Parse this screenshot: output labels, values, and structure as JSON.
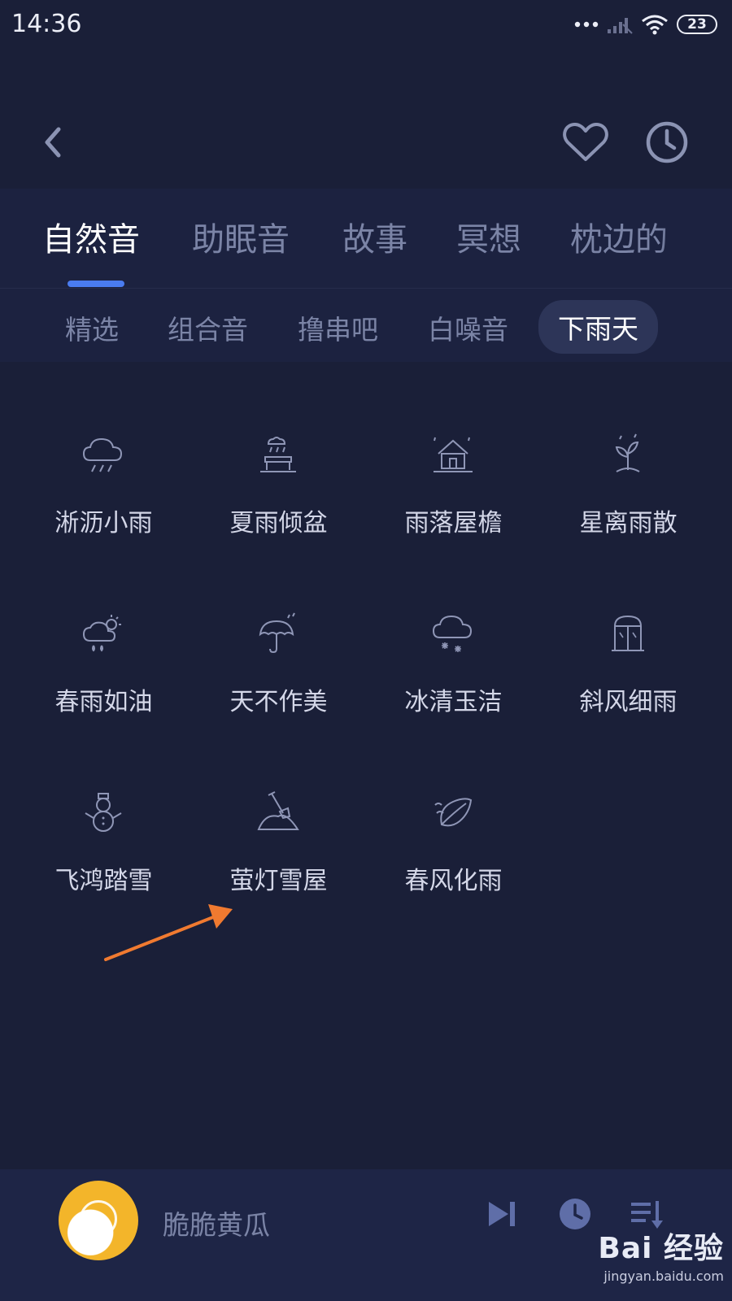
{
  "status": {
    "time": "14:36",
    "battery": "23"
  },
  "nav": {
    "back_icon": "chevron-left-icon",
    "favorite_icon": "heart-icon",
    "history_icon": "clock-icon"
  },
  "tabs": [
    {
      "label": "自然音",
      "active": true
    },
    {
      "label": "助眠音",
      "active": false
    },
    {
      "label": "故事",
      "active": false
    },
    {
      "label": "冥想",
      "active": false
    },
    {
      "label": "枕边的",
      "active": false
    }
  ],
  "subtabs": [
    {
      "label": "精选",
      "active": false
    },
    {
      "label": "组合音",
      "active": false
    },
    {
      "label": "撸串吧",
      "active": false
    },
    {
      "label": "白噪音",
      "active": false
    },
    {
      "label": "下雨天",
      "active": true
    }
  ],
  "sounds": [
    {
      "label": "淅沥小雨",
      "icon": "rain-cloud-icon"
    },
    {
      "label": "夏雨倾盆",
      "icon": "downpour-bench-icon"
    },
    {
      "label": "雨落屋檐",
      "icon": "house-rain-icon"
    },
    {
      "label": "星离雨散",
      "icon": "sprout-rain-icon"
    },
    {
      "label": "春雨如油",
      "icon": "sun-cloud-rain-icon"
    },
    {
      "label": "天不作美",
      "icon": "umbrella-icon"
    },
    {
      "label": "冰清玉洁",
      "icon": "snow-cloud-icon"
    },
    {
      "label": "斜风细雨",
      "icon": "window-icon"
    },
    {
      "label": "飞鸿踏雪",
      "icon": "snowman-icon"
    },
    {
      "label": "萤灯雪屋",
      "icon": "shovel-snow-icon"
    },
    {
      "label": "春风化雨",
      "icon": "leaf-icon"
    }
  ],
  "player": {
    "track": "脆脆黄瓜",
    "album_icon": "play-icon",
    "next_icon": "skip-next-icon",
    "timer_icon": "clock-icon",
    "playlist_icon": "playlist-icon"
  },
  "watermark": {
    "brand": "Bai 经验",
    "url": "jingyan.baidu.com"
  },
  "colors": {
    "background": "#1a1f38",
    "accent": "#4a7cf0",
    "annotation": "#f07a30"
  }
}
